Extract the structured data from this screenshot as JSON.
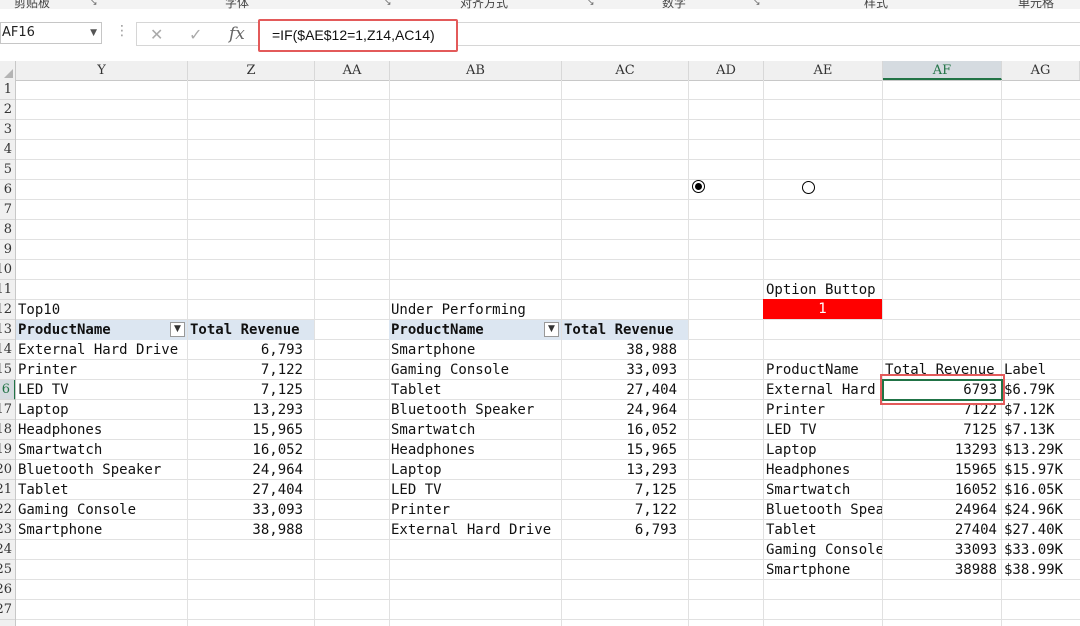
{
  "ribbon": {
    "groups": [
      "剪贴板",
      "字体",
      "对齐方式",
      "数字",
      "样式",
      "单元格"
    ]
  },
  "formula_bar": {
    "name_box": "AF16",
    "formula": "=IF($AE$12=1,Z14,AC14)"
  },
  "columns": [
    "Y",
    "Z",
    "AA",
    "AB",
    "AC",
    "AD",
    "AE",
    "AF",
    "AG"
  ],
  "selected_column": "AF",
  "rows": [
    "1",
    "2",
    "3",
    "4",
    "5",
    "6",
    "7",
    "8",
    "9",
    "10",
    "11",
    "12",
    "13",
    "14",
    "15",
    "16",
    "17",
    "18",
    "19",
    "20",
    "21",
    "22",
    "23",
    "24",
    "25",
    "26",
    "27"
  ],
  "selected_row": "16",
  "top10": {
    "title": "Top10",
    "headers": [
      "ProductName",
      "Total Revenue"
    ],
    "items": [
      {
        "name": "External Hard Drive",
        "revenue": "6,793"
      },
      {
        "name": "Printer",
        "revenue": "7,122"
      },
      {
        "name": "LED TV",
        "revenue": "7,125"
      },
      {
        "name": "Laptop",
        "revenue": "13,293"
      },
      {
        "name": "Headphones",
        "revenue": "15,965"
      },
      {
        "name": "Smartwatch",
        "revenue": "16,052"
      },
      {
        "name": "Bluetooth Speaker",
        "revenue": "24,964"
      },
      {
        "name": "Tablet",
        "revenue": "27,404"
      },
      {
        "name": "Gaming Console",
        "revenue": "33,093"
      },
      {
        "name": "Smartphone",
        "revenue": "38,988"
      }
    ]
  },
  "under": {
    "title": "Under Performing",
    "headers": [
      "ProductName",
      "Total Revenue"
    ],
    "items": [
      {
        "name": "Smartphone",
        "revenue": "38,988"
      },
      {
        "name": "Gaming Console",
        "revenue": "33,093"
      },
      {
        "name": "Tablet",
        "revenue": "27,404"
      },
      {
        "name": "Bluetooth Speaker",
        "revenue": "24,964"
      },
      {
        "name": "Smartwatch",
        "revenue": "16,052"
      },
      {
        "name": "Headphones",
        "revenue": "15,965"
      },
      {
        "name": "Laptop",
        "revenue": "13,293"
      },
      {
        "name": "LED TV",
        "revenue": "7,125"
      },
      {
        "name": "Printer",
        "revenue": "7,122"
      },
      {
        "name": "External Hard Drive",
        "revenue": "6,793"
      }
    ]
  },
  "option": {
    "label": "Option Buttop",
    "value": "1",
    "highlight_color": "#ff0000"
  },
  "helper": {
    "headers": [
      "ProductName",
      "Total Revenue",
      "Label"
    ],
    "items": [
      {
        "name": "External Hard",
        "revenue": "6793",
        "label": "$6.79K"
      },
      {
        "name": "Printer",
        "revenue": "7122",
        "label": "$7.12K"
      },
      {
        "name": "LED TV",
        "revenue": "7125",
        "label": "$7.13K"
      },
      {
        "name": "Laptop",
        "revenue": "13293",
        "label": "$13.29K"
      },
      {
        "name": "Headphones",
        "revenue": "15965",
        "label": "$15.97K"
      },
      {
        "name": "Smartwatch",
        "revenue": "16052",
        "label": "$16.05K"
      },
      {
        "name": "Bluetooth Spea",
        "revenue": "24964",
        "label": "$24.96K"
      },
      {
        "name": "Tablet",
        "revenue": "27404",
        "label": "$27.40K"
      },
      {
        "name": "Gaming Console",
        "revenue": "33093",
        "label": "$33.09K"
      },
      {
        "name": "Smartphone",
        "revenue": "38988",
        "label": "$38.99K"
      }
    ]
  },
  "radio_buttons": [
    {
      "selected": true
    },
    {
      "selected": false
    }
  ],
  "colors": {
    "accent": "#217346",
    "highlight": "#e35a5a",
    "table_header": "#dce6f1"
  }
}
